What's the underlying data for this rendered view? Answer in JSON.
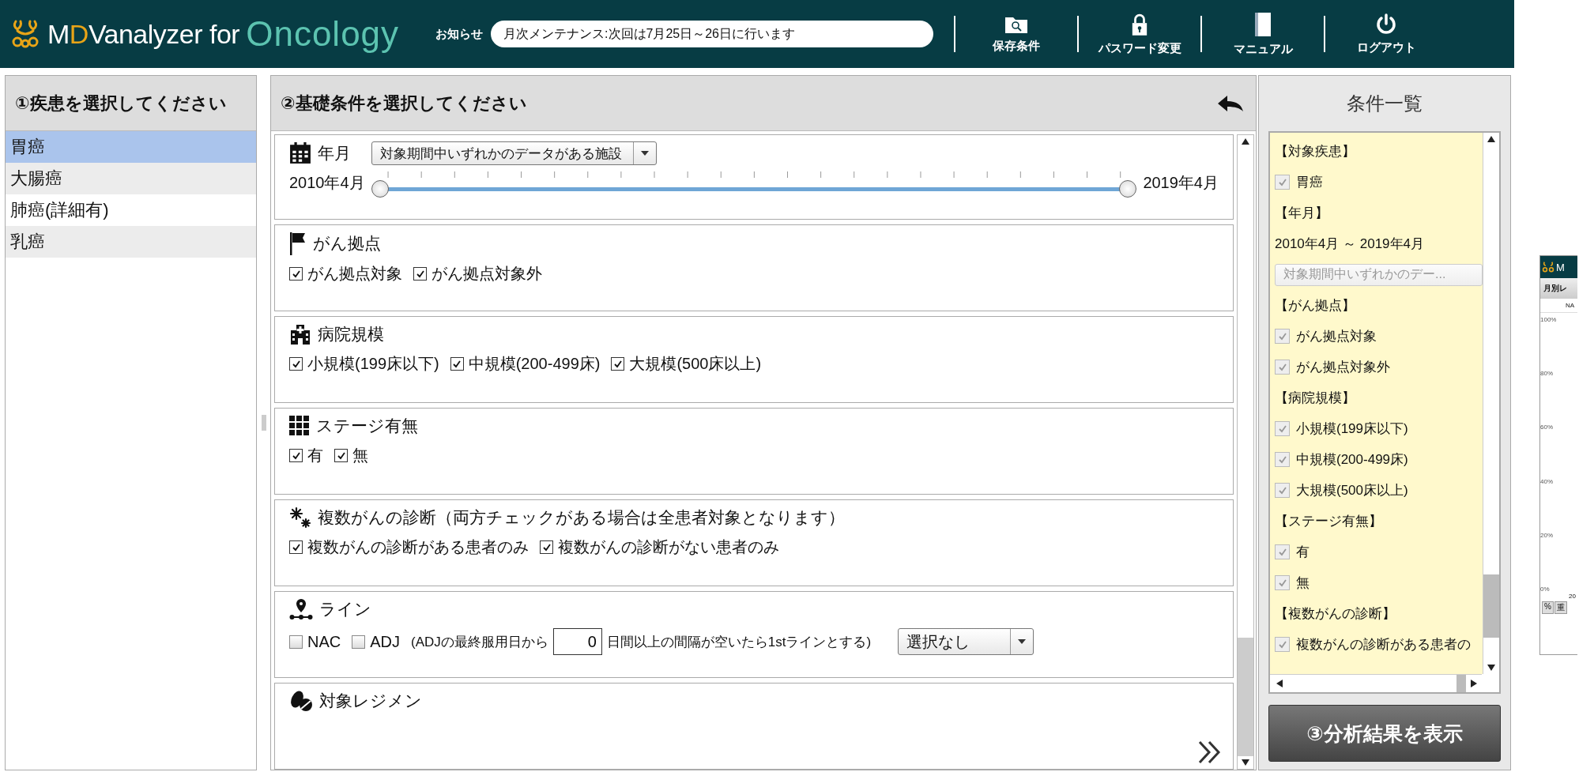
{
  "header": {
    "logo": {
      "before": "M",
      "accent": "D",
      "after": "Vanalyzer for",
      "product": "Oncology"
    },
    "notice": {
      "label": "お知らせ",
      "value": "月次メンテナンス:次回は7月25日～26日に行います"
    },
    "nav": [
      {
        "kind": "saved",
        "label": "保存条件"
      },
      {
        "kind": "password",
        "label": "パスワード変更"
      },
      {
        "kind": "manual",
        "label": "マニュアル"
      },
      {
        "kind": "logout",
        "label": "ログアウト"
      }
    ]
  },
  "disease_panel": {
    "title": "①疾患を選択してください",
    "items": [
      {
        "label": "胃癌",
        "selected": true
      },
      {
        "label": "大腸癌",
        "selected": false
      },
      {
        "label": "肺癌(詳細有)",
        "selected": false
      },
      {
        "label": "乳癌",
        "selected": false
      }
    ]
  },
  "conditions_panel": {
    "title": "②基礎条件を選択してください",
    "sections": [
      {
        "kind": "period",
        "title": "年月",
        "select": "対象期間中いずれかのデータがある施設",
        "start": "2010年4月",
        "end": "2019年4月",
        "level": 1
      },
      {
        "kind": "checks",
        "title": "がん拠点",
        "options": [
          {
            "label": "がん拠点対象",
            "checked": true
          },
          {
            "label": "がん拠点対象外",
            "checked": true
          }
        ]
      },
      {
        "kind": "checks",
        "title": "病院規模",
        "options": [
          {
            "label": "小規模(199床以下)",
            "checked": true
          },
          {
            "label": "中規模(200-499床)",
            "checked": true
          },
          {
            "label": "大規模(500床以上)",
            "checked": true
          }
        ]
      },
      {
        "kind": "checks",
        "title": "ステージ有無",
        "options": [
          {
            "label": "有",
            "checked": true
          },
          {
            "label": "無",
            "checked": true
          }
        ]
      },
      {
        "kind": "checks",
        "title": "複数がんの診断（両方チェックがある場合は全患者対象となります）",
        "options": [
          {
            "label": "複数がんの診断がある患者のみ",
            "checked": true
          },
          {
            "label": "複数がんの診断がない患者のみ",
            "checked": true
          }
        ]
      },
      {
        "kind": "line",
        "title": "ライン",
        "options": [
          {
            "label": "NAC",
            "checked": false
          },
          {
            "label": "ADJ",
            "checked": false
          }
        ],
        "note_before": "(ADJの最終服用日から",
        "days": "0",
        "note_after": "日間以上の間隔が空いたら1stラインとする)",
        "select": "選択なし"
      },
      {
        "kind": "regimen",
        "title": "対象レジメン"
      }
    ]
  },
  "summary_panel": {
    "title": "条件一覧",
    "items": [
      {
        "kind": "heading",
        "text": "【対象疾患】"
      },
      {
        "kind": "check",
        "text": "胃癌",
        "checked": true
      },
      {
        "kind": "heading",
        "text": "【年月】"
      },
      {
        "kind": "text",
        "text": "2010年4月 ～ 2019年4月"
      },
      {
        "kind": "select",
        "text": "対象期間中いずれかのデー..."
      },
      {
        "kind": "heading",
        "text": "【がん拠点】"
      },
      {
        "kind": "check",
        "text": "がん拠点対象",
        "checked": true
      },
      {
        "kind": "check",
        "text": "がん拠点対象外",
        "checked": true
      },
      {
        "kind": "heading",
        "text": "【病院規模】"
      },
      {
        "kind": "check",
        "text": "小規模(199床以下)",
        "checked": true
      },
      {
        "kind": "check",
        "text": "中規模(200-499床)",
        "checked": true
      },
      {
        "kind": "check",
        "text": "大規模(500床以上)",
        "checked": true
      },
      {
        "kind": "heading",
        "text": "【ステージ有無】"
      },
      {
        "kind": "check",
        "text": "有",
        "checked": true
      },
      {
        "kind": "check",
        "text": "無",
        "checked": true
      },
      {
        "kind": "heading",
        "text": "【複数がんの診断】"
      },
      {
        "kind": "check",
        "text": "複数がんの診断がある患者の",
        "checked": true
      }
    ],
    "button": "③分析結果を表示"
  },
  "preview_window": {
    "title": "M",
    "tab": "月別レ",
    "column": "NA",
    "y_labels": [
      "100%",
      "80%",
      "60%",
      "40%",
      "20%",
      "0%"
    ],
    "x_label": "20",
    "buttons": [
      "%",
      "重"
    ]
  }
}
